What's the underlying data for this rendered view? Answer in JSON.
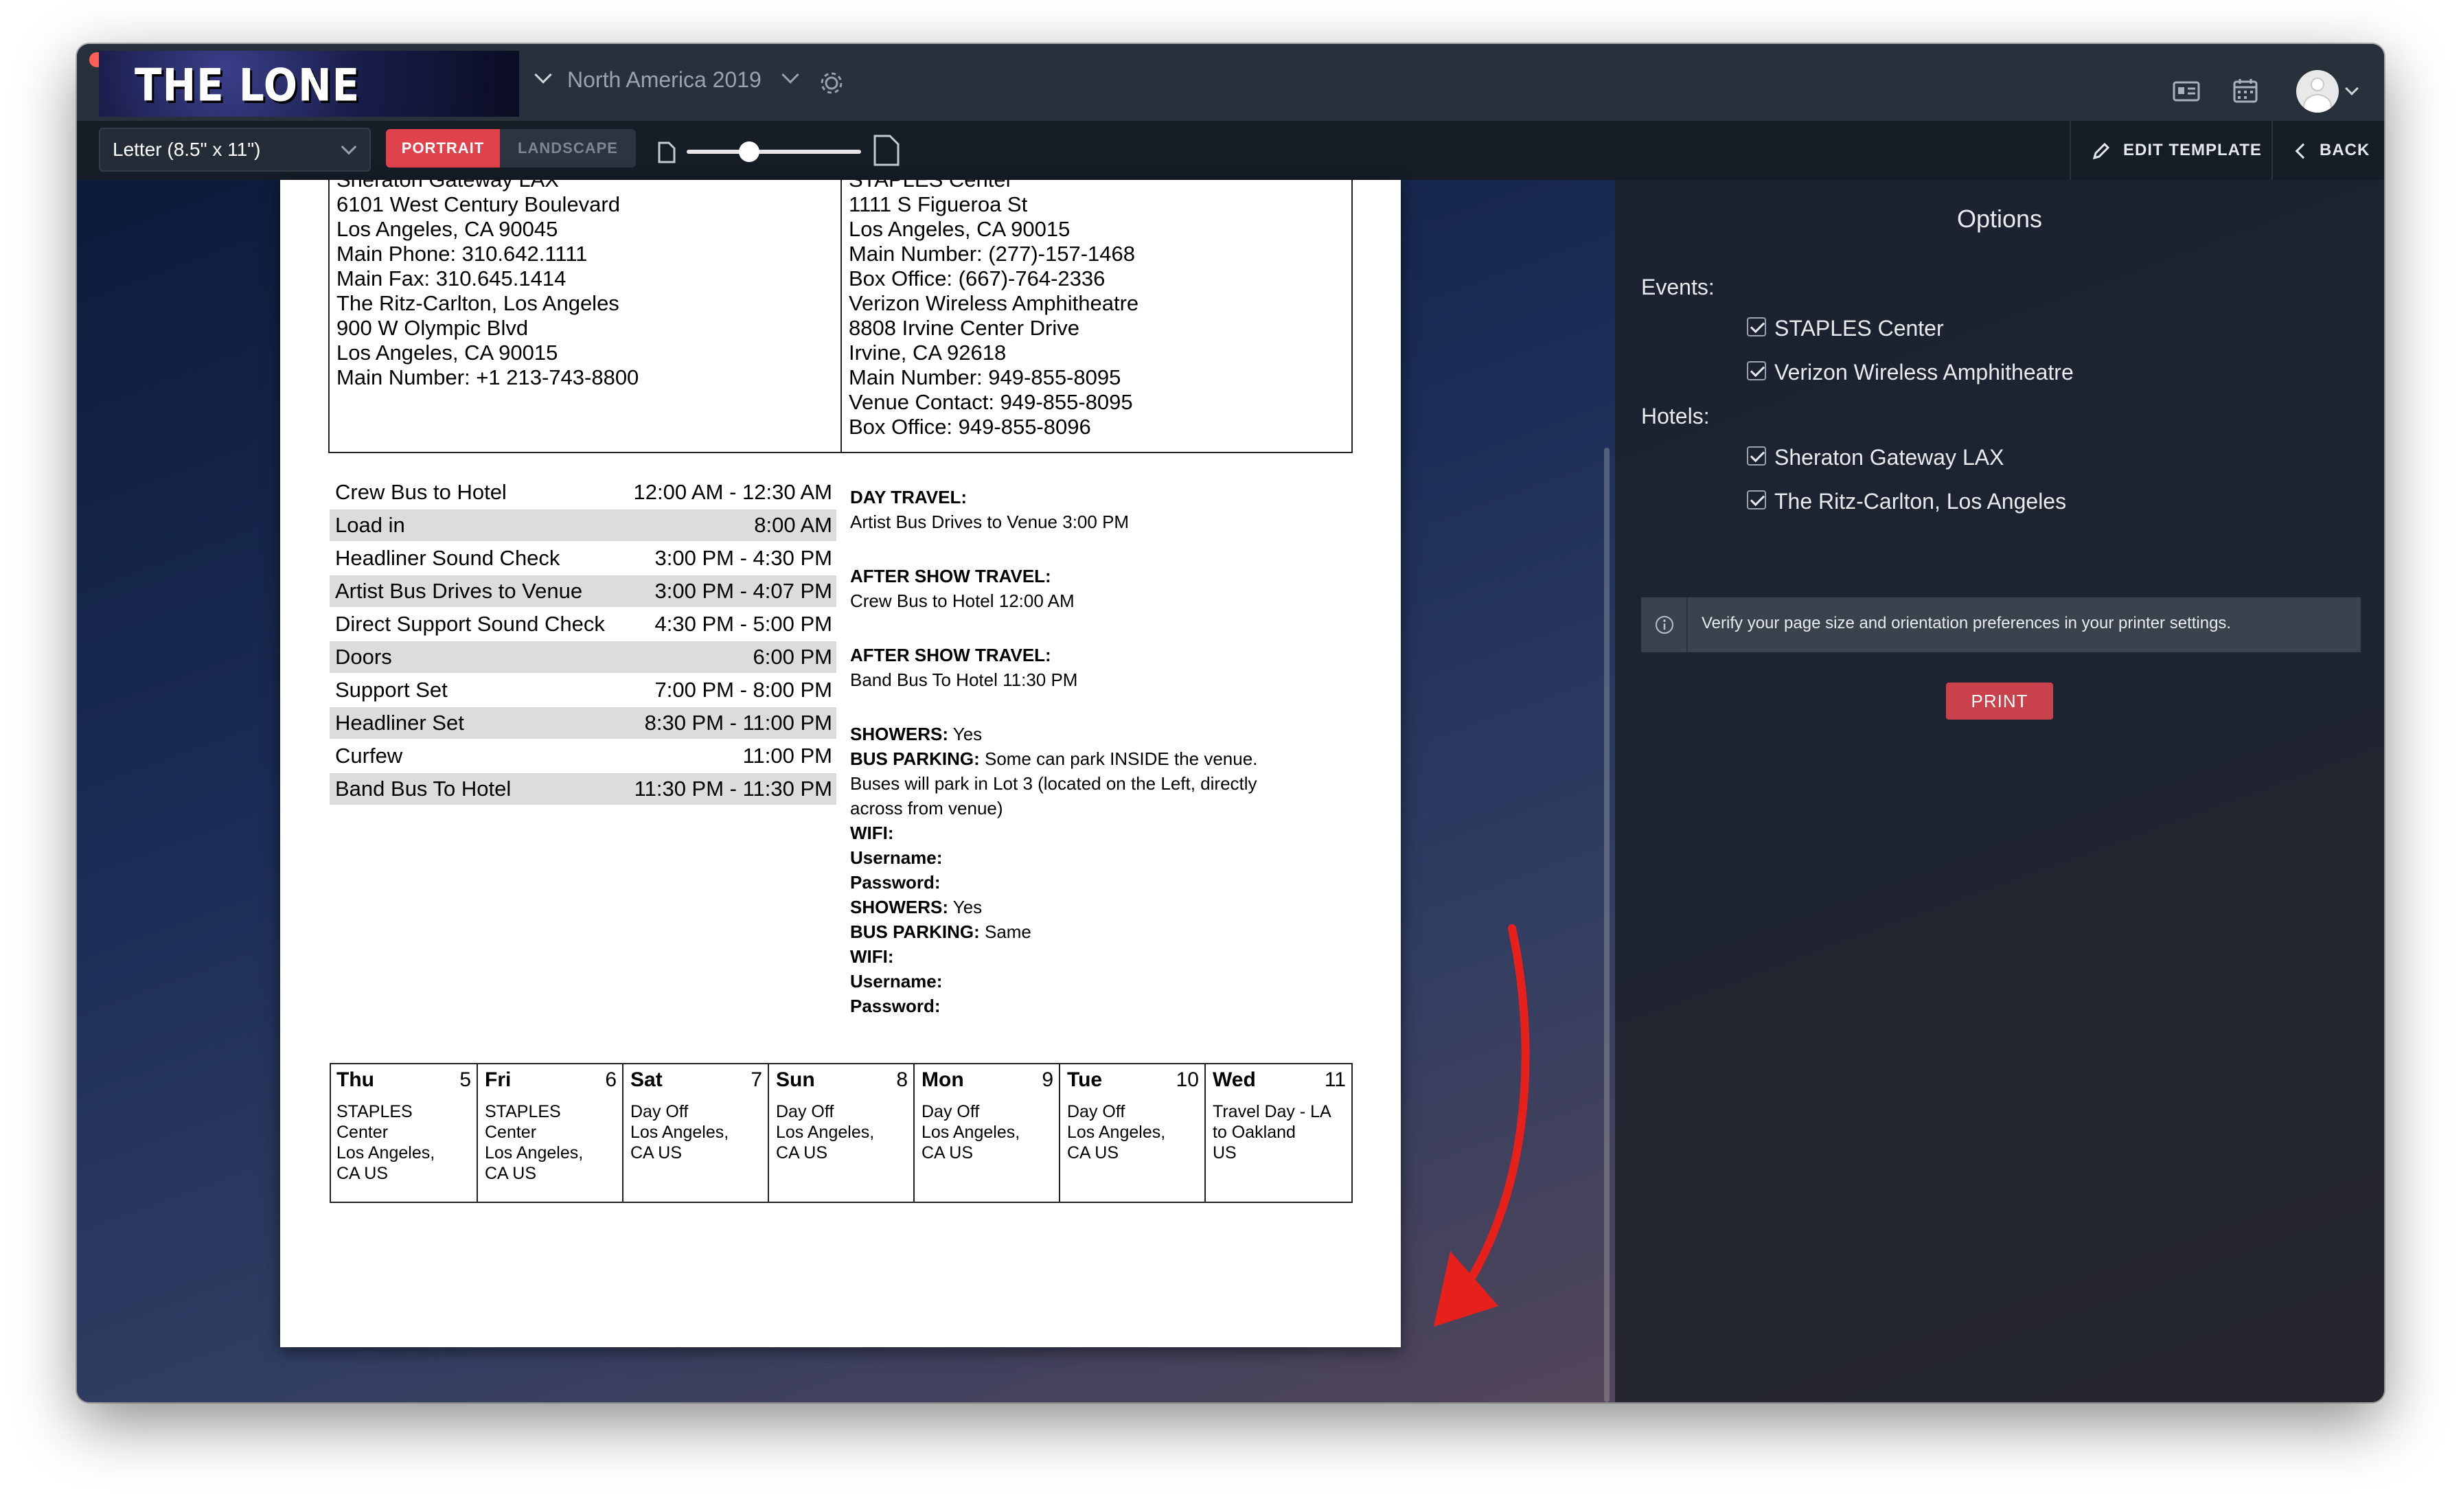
{
  "app": {
    "title": "THE LONE RANGERS",
    "tour": "North America 2019",
    "toolbar": {
      "paper_size": "Letter (8.5\" x 11\")",
      "portrait": "PORTRAIT",
      "landscape": "LANDSCAPE",
      "zoom_percent": 25,
      "edit_template": "EDIT TEMPLATE",
      "back": "BACK"
    },
    "colors": {
      "accent": "#e0424b",
      "print_button": "#c9414a"
    }
  },
  "paper": {
    "hotels": [
      "Sheraton Gateway LAX",
      "6101 West Century Boulevard",
      "Los Angeles, CA 90045",
      "Main Phone: 310.642.1111",
      "Main Fax: 310.645.1414",
      "The Ritz-Carlton, Los Angeles",
      "900 W Olympic Blvd",
      "Los Angeles, CA 90015",
      "Main Number: +1 213-743-8800"
    ],
    "venues": [
      "STAPLES Center",
      "1111 S Figueroa St",
      "Los Angeles, CA 90015",
      "Main Number: (277)-157-1468",
      "Box Office: (667)-764-2336",
      "Verizon Wireless Amphitheatre",
      "8808 Irvine Center Drive",
      "Irvine, CA 92618",
      "Main Number: 949-855-8095",
      "Venue Contact: 949-855-8095",
      "Box Office: 949-855-8096"
    ],
    "schedule": [
      {
        "name": "Crew Bus to Hotel",
        "time": "12:00 AM - 12:30 AM"
      },
      {
        "name": "Load in",
        "time": "8:00 AM"
      },
      {
        "name": "Headliner Sound Check",
        "time": "3:00 PM - 4:30 PM"
      },
      {
        "name": "Artist Bus Drives to Venue",
        "time": "3:00 PM - 4:07 PM"
      },
      {
        "name": "Direct Support Sound Check",
        "time": "4:30 PM - 5:00 PM"
      },
      {
        "name": "Doors",
        "time": "6:00 PM"
      },
      {
        "name": "Support Set",
        "time": "7:00 PM - 8:00 PM"
      },
      {
        "name": "Headliner Set",
        "time": "8:30 PM - 11:00 PM"
      },
      {
        "name": "Curfew",
        "time": "11:00 PM"
      },
      {
        "name": "Band Bus To Hotel",
        "time": "11:30 PM - 11:30 PM"
      }
    ],
    "notes": {
      "day_travel_label": "DAY TRAVEL:",
      "day_travel_text": "Artist Bus Drives to Venue 3:00 PM",
      "after_show_label": "AFTER SHOW TRAVEL:",
      "after_show_1": "Crew Bus to Hotel 12:00 AM",
      "after_show_2": "Band Bus To Hotel 11:30 PM",
      "showers_label": "SHOWERS:",
      "showers_value": " Yes",
      "bus_parking_label": "BUS PARKING:",
      "bus_parking_1_line1": " Some can park INSIDE the venue.",
      "bus_parking_1_line2": "Buses will park in Lot 3 (located on the Left, directly",
      "bus_parking_1_line3": "across from venue)",
      "bus_parking_2": " Same",
      "wifi_label": "WIFI:",
      "username_label": "Username:",
      "password_label": "Password:"
    },
    "calendar": [
      {
        "day": "Thu",
        "num": "5",
        "lines": [
          "STAPLES",
          "Center",
          "Los Angeles,",
          "CA US"
        ]
      },
      {
        "day": "Fri",
        "num": "6",
        "lines": [
          "STAPLES",
          "Center",
          "Los Angeles,",
          "CA US"
        ]
      },
      {
        "day": "Sat",
        "num": "7",
        "lines": [
          "Day Off",
          "Los Angeles,",
          "CA US"
        ]
      },
      {
        "day": "Sun",
        "num": "8",
        "lines": [
          "Day Off",
          "Los Angeles,",
          "CA US"
        ]
      },
      {
        "day": "Mon",
        "num": "9",
        "lines": [
          "Day Off",
          "Los Angeles,",
          "CA US"
        ]
      },
      {
        "day": "Tue",
        "num": "10",
        "lines": [
          "Day Off",
          "Los Angeles,",
          "CA US"
        ]
      },
      {
        "day": "Wed",
        "num": "11",
        "lines": [
          "Travel Day - LA",
          "to Oakland",
          "US"
        ]
      }
    ]
  },
  "options": {
    "title": "Options",
    "events_label": "Events:",
    "events": [
      "STAPLES Center",
      "Verizon Wireless Amphitheatre"
    ],
    "hotels_label": "Hotels:",
    "hotels": [
      "Sheraton Gateway LAX",
      "The Ritz-Carlton, Los Angeles"
    ],
    "info": "Verify your page size and orientation preferences in your printer settings.",
    "print": "PRINT"
  }
}
